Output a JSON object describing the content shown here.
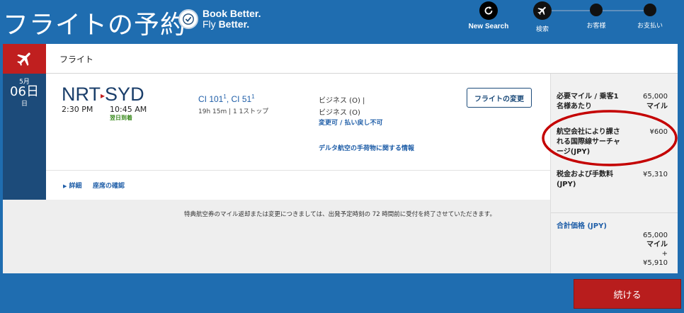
{
  "header": {
    "title": "フライトの予約",
    "brand_line1": "Book Better.",
    "brand_line2_prefix": "Fly ",
    "brand_line2_bold": "Better.",
    "new_search_label": "New Search",
    "steps": [
      "検索",
      "お客様",
      "お支払い"
    ]
  },
  "section": {
    "title": "フライト"
  },
  "flight": {
    "month": "5月",
    "day": "06日",
    "weekday": "日",
    "origin": "NRT",
    "destination": "SYD",
    "depart_time": "2:30 PM",
    "arrive_time": "10:45 AM",
    "next_day_label": "翌日到着",
    "flight_1": "CI 101",
    "flight_1_sup": "1",
    "flight_sep": ", ",
    "flight_2": "CI 51",
    "flight_2_sup": "1",
    "duration": "19h 15m | 1 1ストップ",
    "cabin_1": "ビジネス (O) |",
    "cabin_2": "ビジネス (O)",
    "fare_rule": "変更可 / 払い戻し不可",
    "baggage_link": "デルタ航空の手荷物に関する情報",
    "change_button": "フライトの変更",
    "details_link": "詳細",
    "seat_link": "座席の確認"
  },
  "notice": "特典航空券のマイル返却または変更につきましては、出発予定時刻の 72 時間前に受付を終了させていただきます。",
  "summary": {
    "miles_label": "必要マイル / 乗客1名様あたり",
    "miles_value": "65,000",
    "miles_unit": "マイル",
    "surcharge_label": "航空会社により課される国際線サーチャージ(JPY)",
    "surcharge_value": "¥600",
    "tax_label": "税金および手数料(JPY)",
    "tax_value": "¥5,310",
    "total_label": "合計価格 (JPY)",
    "total_miles": "65,000",
    "total_miles_unit": "マイル",
    "total_plus": "+",
    "total_yen": "¥5,910"
  },
  "continue_button": "続ける",
  "colors": {
    "background": "#1f6db0",
    "navy": "#1c4b7a",
    "red": "#c01f1f",
    "link": "#1f5ea8",
    "highlight": "#c40000"
  }
}
